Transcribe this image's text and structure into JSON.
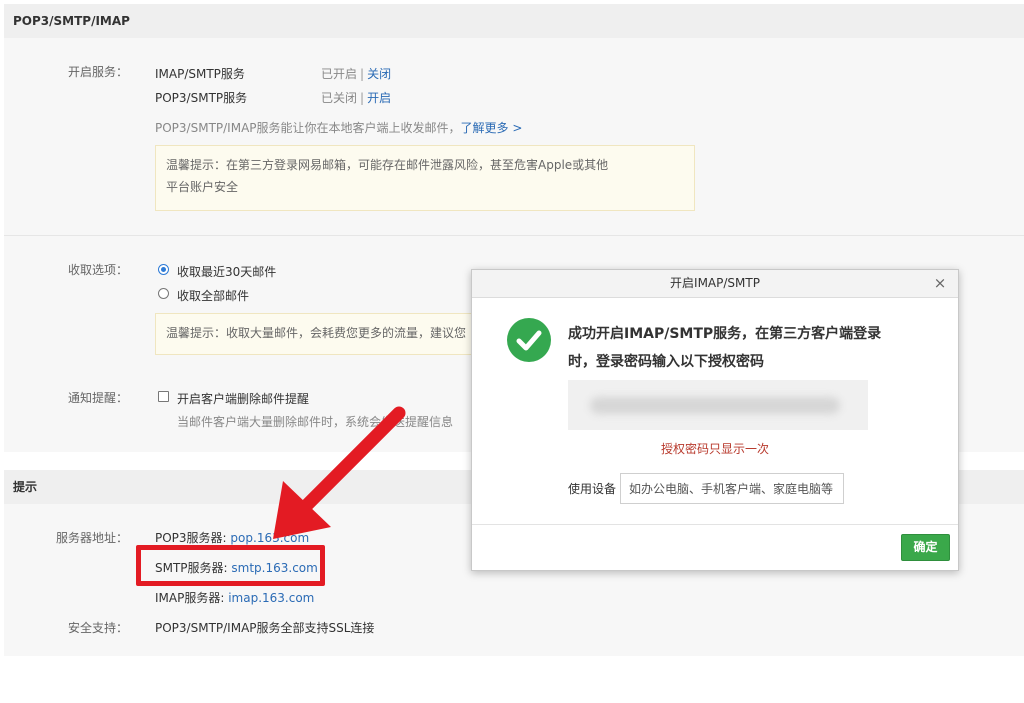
{
  "sections": {
    "pop3": {
      "title": "POP3/SMTP/IMAP"
    },
    "tips": {
      "title": "提示"
    }
  },
  "services": {
    "label": "开启服务：",
    "items": [
      {
        "name": "IMAP/SMTP服务",
        "status": "已开启",
        "action": "关闭"
      },
      {
        "name": "POP3/SMTP服务",
        "status": "已关闭",
        "action": "开启"
      }
    ],
    "description": "POP3/SMTP/IMAP服务能让你在本地客户端上收发邮件，",
    "learn_more": "了解更多 >",
    "tip_line1": "温馨提示：在第三方登录网易邮箱，可能存在邮件泄露风险，甚至危害Apple或其他",
    "tip_line2": "平台账户安全"
  },
  "receive": {
    "label": "收取选项：",
    "options": [
      "收取最近30天邮件",
      "收取全部邮件"
    ],
    "selected": "收取最近30天邮件",
    "tip": "温馨提示：收取大量邮件，会耗费您更多的流量，建议您"
  },
  "notify": {
    "label": "通知提醒：",
    "checkbox_label": "开启客户端删除邮件提醒",
    "desc": "当邮件客户端大量删除邮件时，系统会发送提醒信息"
  },
  "servers": {
    "label": "服务器地址：",
    "pop3_label": "POP3服务器: ",
    "pop3_host": "pop.163.com",
    "smtp_label": "SMTP服务器: ",
    "smtp_host": "smtp.163.com",
    "imap_label": "IMAP服务器: ",
    "imap_host": "imap.163.com",
    "security_label": "安全支持：",
    "security_text": "POP3/SMTP/IMAP服务全部支持SSL连接"
  },
  "dialog": {
    "title": "开启IMAP/SMTP",
    "close": "×",
    "message": "成功开启IMAP/SMTP服务，在第三方客户端登录时，登录密码输入以下授权密码",
    "password_note": "授权密码只显示一次",
    "device_label": "使用设备",
    "device_placeholder": "如办公电脑、手机客户端、家庭电脑等",
    "ok_button": "确定"
  },
  "colors": {
    "link": "#2b6bb5",
    "success": "#35a850",
    "ok_button": "#3aa84a",
    "highlight": "#e31b23",
    "warning_text": "#b8392c"
  }
}
